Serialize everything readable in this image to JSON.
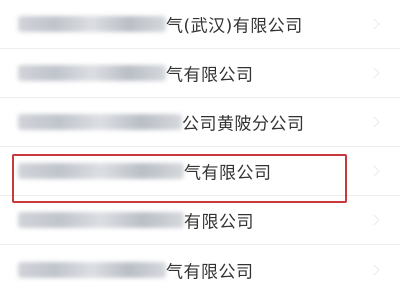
{
  "company_list": {
    "items": [
      {
        "text": "气(武汉)有限公司"
      },
      {
        "text": "气有限公司"
      },
      {
        "text": "公司黄陂分公司"
      },
      {
        "text": "气有限公司"
      },
      {
        "text": "有限公司"
      },
      {
        "text": "气有限公司"
      }
    ],
    "highlighted_index": 3,
    "highlight_color": "#c9383c"
  }
}
